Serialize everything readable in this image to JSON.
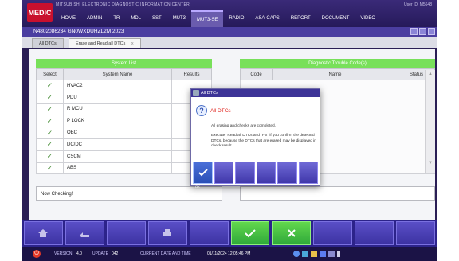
{
  "app": {
    "brand": "MITSUBISHI ELECTRONIC DIAGNOSTIC INFORMATION CENTER",
    "logo": "MEDIC",
    "user": "User ID: M5648",
    "menu": [
      "HOME",
      "ADMIN",
      "TR",
      "MDL",
      "SST",
      "MUT3",
      "MUT3-SE",
      "RADIO",
      "ASA-CAPS",
      "REPORT",
      "DOCUMENT",
      "VIDEO"
    ],
    "active_menu": "MUT3-SE"
  },
  "window": {
    "title": "N4802086234 GN0WXDUHZL2M 2023"
  },
  "tabs": {
    "first": "All DTCs",
    "second": "Erase and Read all DTCs",
    "close": "x"
  },
  "system_list": {
    "title": "System List",
    "headers": [
      "Select",
      "System Name",
      "Results"
    ],
    "rows": [
      {
        "check": "✓",
        "name": "HVAC2",
        "result": ""
      },
      {
        "check": "✓",
        "name": "PDU",
        "result": ""
      },
      {
        "check": "✓",
        "name": "R MCU",
        "result": ""
      },
      {
        "check": "✓",
        "name": "P LOCK",
        "result": ""
      },
      {
        "check": "✓",
        "name": "OBC",
        "result": ""
      },
      {
        "check": "✓",
        "name": "DC/DC",
        "result": ""
      },
      {
        "check": "✓",
        "name": "CSCM",
        "result": ""
      },
      {
        "check": "✓",
        "name": "ABS",
        "result": ""
      }
    ]
  },
  "dtc_panel": {
    "title": "Diagnostic Trouble Code(s)",
    "headers": [
      "Code",
      "Name",
      "Status"
    ]
  },
  "status_text": "Now Checking!",
  "modal": {
    "title": "All DTCs",
    "heading": "All DTCs",
    "line1": "All erasing and checks are completed.",
    "line2": "Execute \"Read all DTCs and \"Fix\" if you confirm the detected DTCs, because the DTCs that are erased may be displayed in check result.",
    "ok_label": "OK"
  },
  "statusbar": {
    "version_label": "VERSION",
    "version": "4.0",
    "update_label": "UPDATE",
    "update": "042",
    "time_label": "CURRENT DATE AND TIME",
    "time": "01/11/2024 12:05:46 PM"
  }
}
